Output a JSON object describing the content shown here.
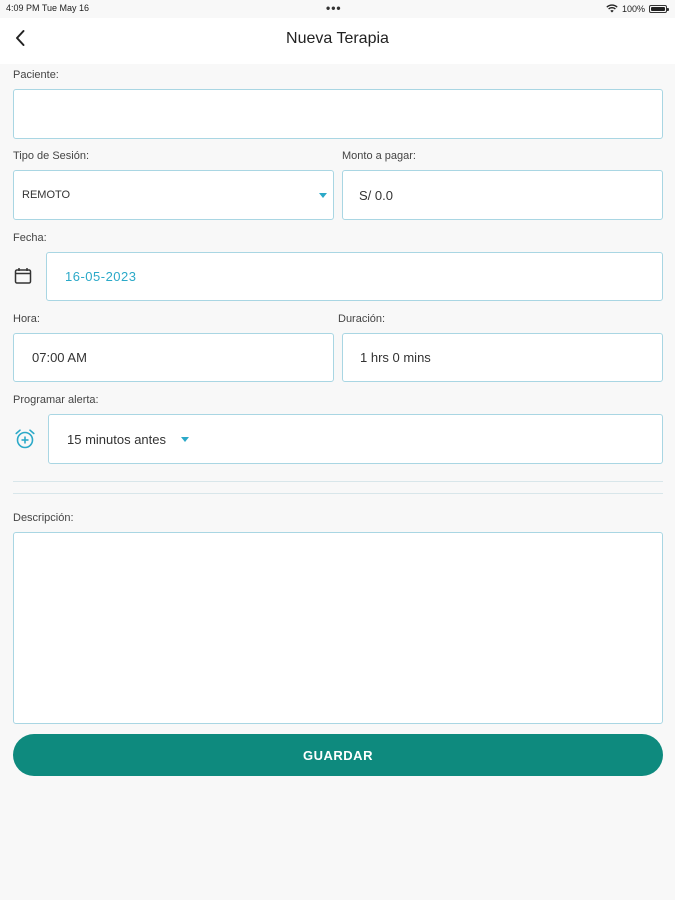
{
  "status_bar": {
    "time_date": "4:09 PM   Tue May 16",
    "dots": "•••",
    "battery_pct": "100%"
  },
  "header": {
    "title": "Nueva Terapia"
  },
  "form": {
    "paciente": {
      "label": "Paciente:",
      "value": ""
    },
    "tipo_sesion": {
      "label": "Tipo de Sesión:",
      "value": "REMOTO"
    },
    "monto": {
      "label": "Monto a pagar:",
      "value": "S/ 0.0"
    },
    "fecha": {
      "label": "Fecha:",
      "value": "16-05-2023"
    },
    "hora": {
      "label": "Hora:",
      "value": "07:00 AM"
    },
    "duracion": {
      "label": "Duración:",
      "value": "1 hrs 0 mins"
    },
    "alerta": {
      "label": "Programar alerta:",
      "value": "15 minutos antes"
    },
    "descripcion": {
      "label": "Descripción:",
      "value": ""
    }
  },
  "actions": {
    "save_label": "GUARDAR"
  },
  "colors": {
    "accent": "#2ba9c8",
    "primary_button": "#0e8a7e",
    "field_border": "#a9d6e3",
    "background": "#f8f8f8"
  },
  "icons": {
    "back": "chevron-left-icon",
    "calendar": "calendar-icon",
    "alarm": "alarm-add-icon",
    "wifi": "wifi-icon",
    "battery": "battery-icon"
  }
}
